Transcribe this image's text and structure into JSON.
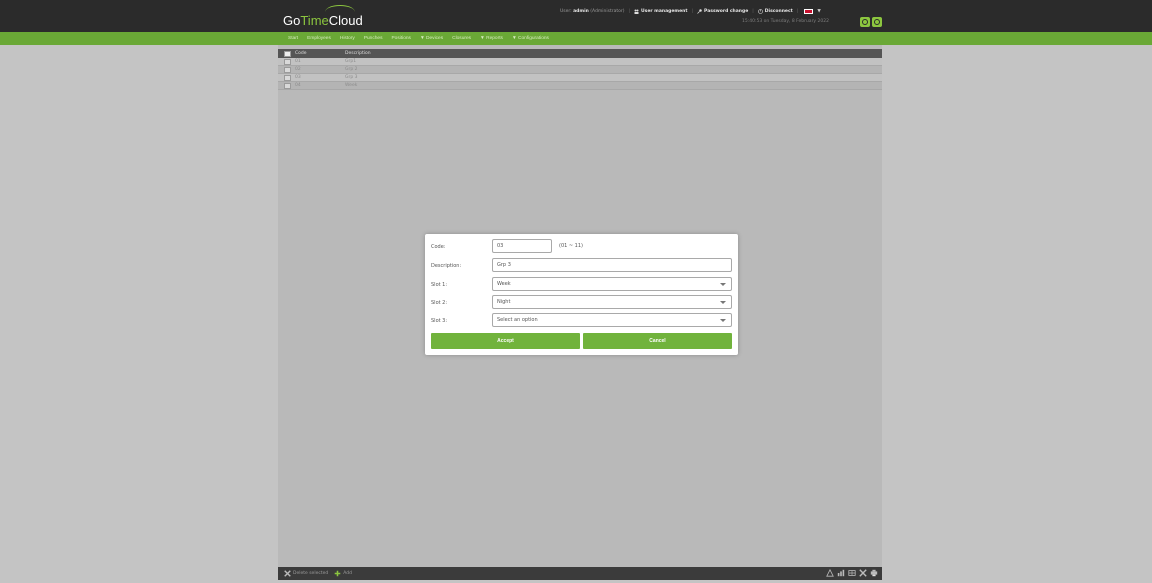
{
  "app": {
    "logo": {
      "part1": "Go",
      "part2": "Time",
      "part3": "Cloud"
    },
    "user_prefix": "User:",
    "user_name": "admin",
    "user_role": "(Administrator)",
    "links": [
      {
        "label": "User management",
        "icon": "users-icon"
      },
      {
        "label": "Password change",
        "icon": "key-icon"
      },
      {
        "label": "Disconnect",
        "icon": "power-icon"
      }
    ],
    "datetime": "15:40:53 on Tuesday, 8 February 2022",
    "accent_color": "#6aa836"
  },
  "menu": [
    "Start",
    "Employees",
    "History",
    "Punches",
    "Positions",
    "▼ Devices",
    "Closures",
    "▼ Reports",
    "▼ Configurations"
  ],
  "table": {
    "headers": {
      "code": "Code",
      "description": "Description"
    },
    "rows": [
      {
        "code": "01",
        "description": "Grp1"
      },
      {
        "code": "02",
        "description": "Grp 2"
      },
      {
        "code": "03",
        "description": "Grp 3"
      },
      {
        "code": "04",
        "description": "Week"
      }
    ]
  },
  "footer": {
    "delete_label": "Delete selected",
    "add_label": "Add"
  },
  "dialog": {
    "code_label": "Code:",
    "code_value": "03",
    "code_range": "(01 ~ 11)",
    "description_label": "Description:",
    "description_value": "Grp 3",
    "slot1_label": "Slot 1:",
    "slot1_value": "Week",
    "slot2_label": "Slot 2:",
    "slot2_value": "Night",
    "slot3_label": "Slot 3:",
    "slot3_value": "Select an option",
    "accept_label": "Accept",
    "cancel_label": "Cancel"
  }
}
